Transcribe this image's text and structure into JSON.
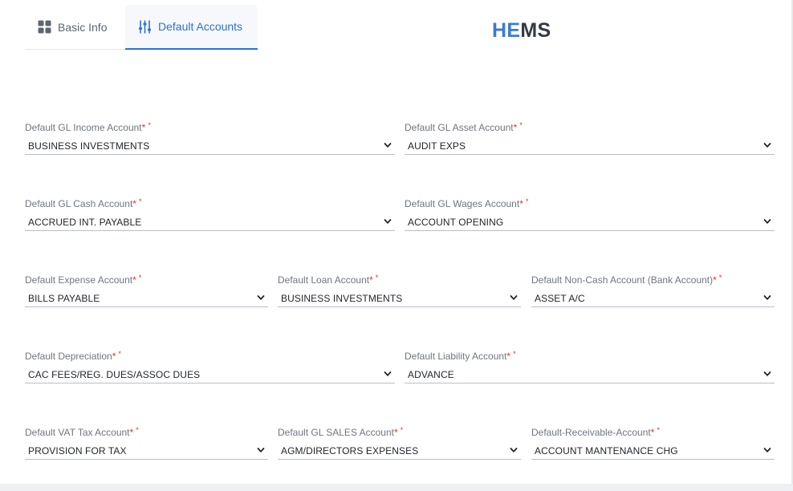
{
  "tabs": {
    "basic_info": "Basic Info",
    "default_accounts": "Default Accounts"
  },
  "brand": {
    "part1": "HE",
    "part2": "MS"
  },
  "required_mark": "*",
  "fields": {
    "gl_income": {
      "label": "Default GL Income Account",
      "value": "BUSINESS INVESTMENTS"
    },
    "gl_asset": {
      "label": "Default GL Asset Account",
      "value": "AUDIT EXPS"
    },
    "gl_cash": {
      "label": "Default GL Cash Account",
      "value": "ACCRUED INT. PAYABLE"
    },
    "gl_wages": {
      "label": "Default GL Wages Account",
      "value": "ACCOUNT OPENING"
    },
    "expense": {
      "label": "Default Expense Account",
      "value": "BILLS PAYABLE"
    },
    "loan": {
      "label": "Default Loan Account",
      "value": "BUSINESS INVESTMENTS"
    },
    "non_cash": {
      "label": "Default Non-Cash Account (Bank Account)",
      "value": "ASSET A/C"
    },
    "depreciation": {
      "label": "Default Depreciation",
      "value": "CAC FEES/REG. DUES/ASSOC DUES"
    },
    "liability": {
      "label": "Default Liability Account",
      "value": "ADVANCE"
    },
    "vat_tax": {
      "label": "Default VAT Tax Account",
      "value": "PROVISION FOR TAX"
    },
    "gl_sales": {
      "label": "Default GL SALES Account",
      "value": "AGM/DIRECTORS EXPENSES"
    },
    "receivable": {
      "label": "Default-Receivable-Account",
      "value": "ACCOUNT MANTENANCE CHG"
    }
  },
  "colors": {
    "accent": "#2f6fd6",
    "required": "#e0342c",
    "brand_blue": "#3a7bd5",
    "brand_dark": "#333a44"
  }
}
